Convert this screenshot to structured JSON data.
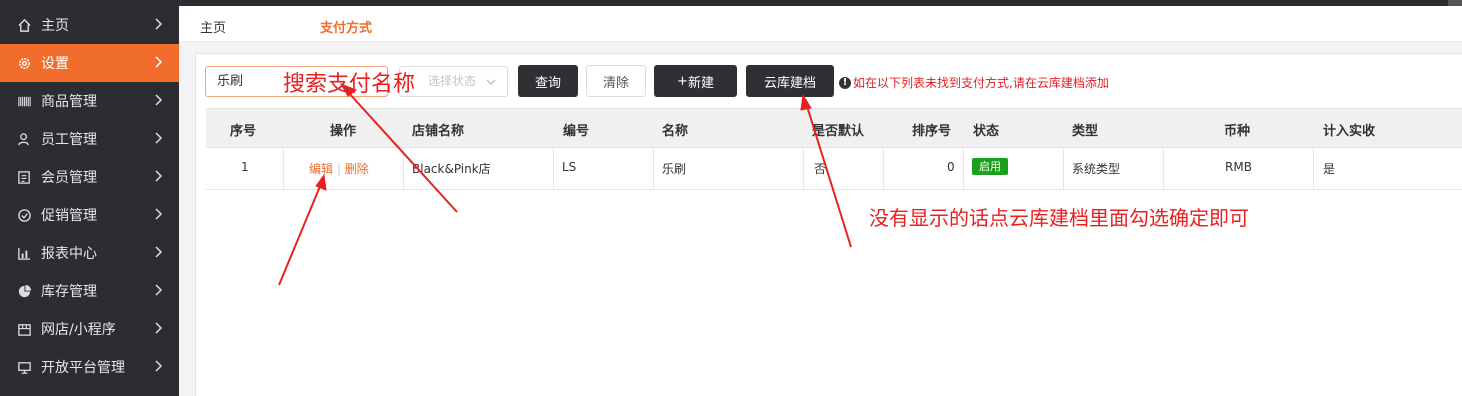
{
  "sidebar": {
    "items": [
      {
        "label": "主页",
        "icon": "home-icon"
      },
      {
        "label": "设置",
        "icon": "gear-icon",
        "active": true
      },
      {
        "label": "商品管理",
        "icon": "barcode-icon"
      },
      {
        "label": "员工管理",
        "icon": "user-icon"
      },
      {
        "label": "会员管理",
        "icon": "id-card-icon"
      },
      {
        "label": "促销管理",
        "icon": "check-circle-icon"
      },
      {
        "label": "报表中心",
        "icon": "bar-chart-icon"
      },
      {
        "label": "库存管理",
        "icon": "pie-chart-icon"
      },
      {
        "label": "网店/小程序",
        "icon": "store-icon"
      },
      {
        "label": "开放平台管理",
        "icon": "monitor-icon"
      }
    ]
  },
  "tabs": {
    "home": "主页",
    "active": "支付方式"
  },
  "toolbar": {
    "search_value": "乐刷",
    "status_placeholder": "选择状态",
    "query_label": "查询",
    "clear_label": "清除",
    "new_label": "新建",
    "cloud_label": "云库建档",
    "tip": "如在以下列表未找到支付方式,请在云库建档添加"
  },
  "table": {
    "headers": [
      "序号",
      "操作",
      "店铺名称",
      "编号",
      "名称",
      "是否默认",
      "排序号",
      "状态",
      "类型",
      "币种",
      "计入实收"
    ],
    "rows": [
      {
        "index": "1",
        "edit": "编辑",
        "delete": "删除",
        "store": "Black&Pink店",
        "code": "LS",
        "name": "乐刷",
        "is_default": "否",
        "sort": "0",
        "status": "启用",
        "type": "系统类型",
        "currency": "RMB",
        "counted": "是"
      }
    ]
  },
  "annotations": {
    "search_note": "搜索支付名称",
    "cloud_note": "没有显示的话点云库建档里面勾选确定即可"
  },
  "colors": {
    "accent": "#f06d2d",
    "sidebar_bg": "#2b2d33",
    "status_green": "#1aa01a",
    "annotation_red": "#e82020"
  }
}
